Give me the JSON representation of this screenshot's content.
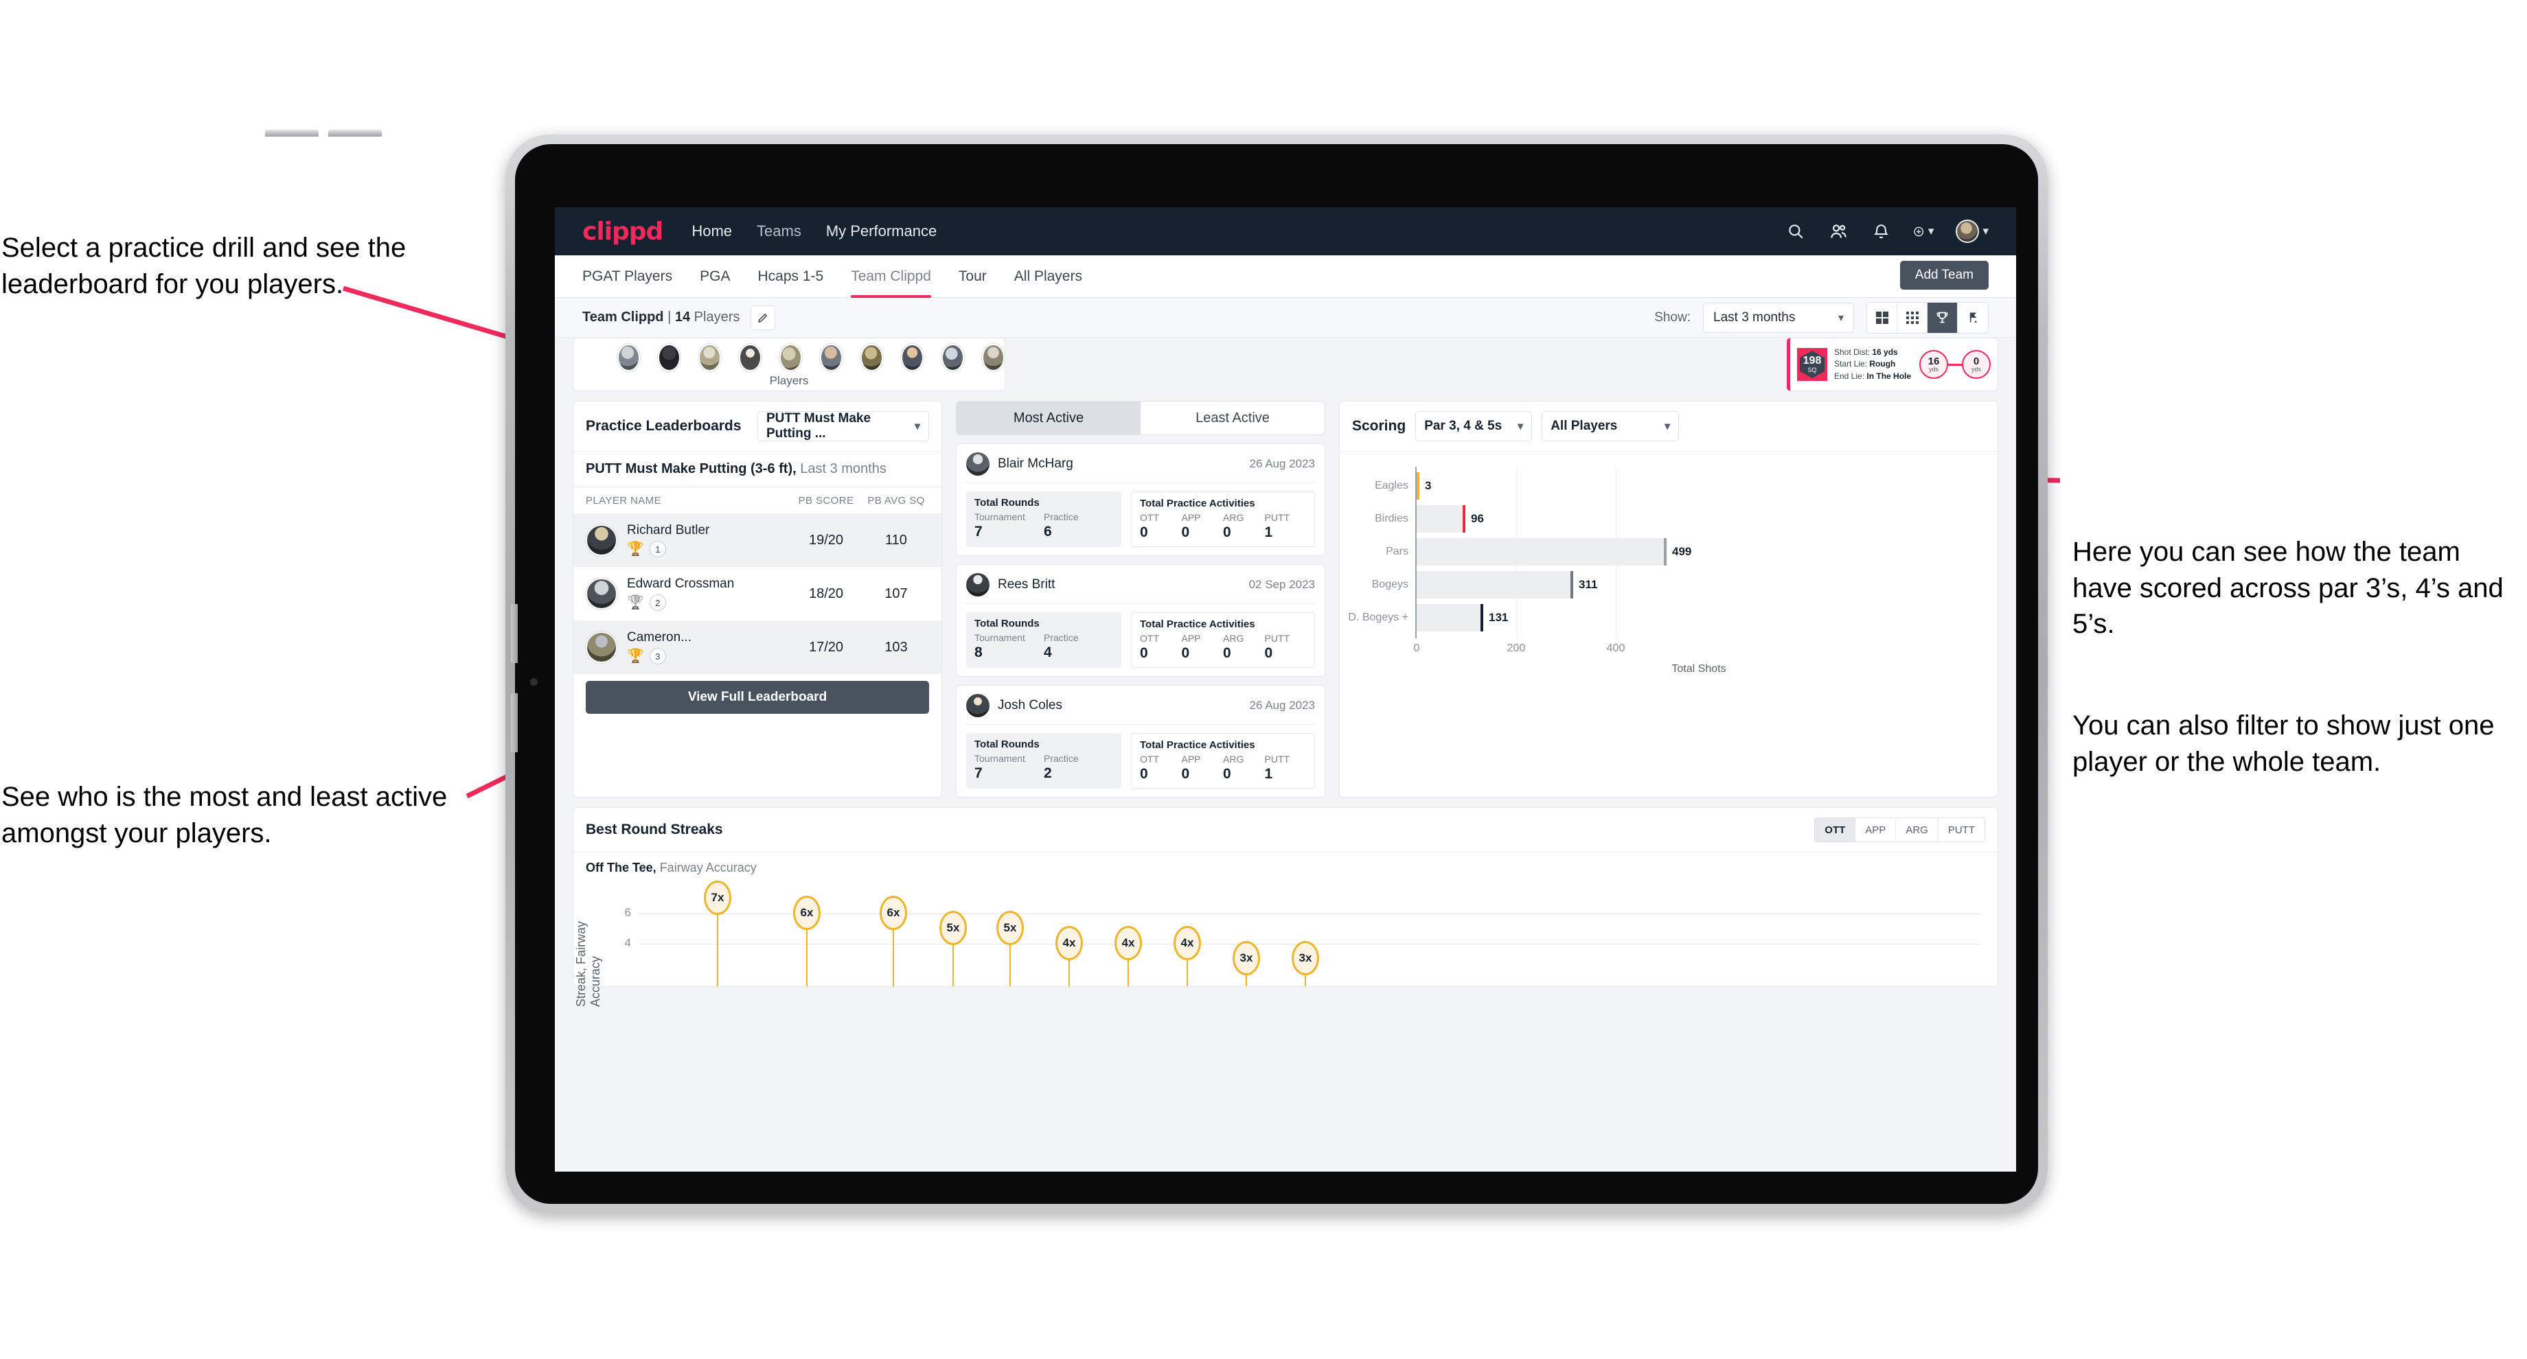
{
  "annotations": {
    "top_left": "Select a practice drill and see the leaderboard for you players.",
    "bottom_left": "See who is the most and least active amongst your players.",
    "right_1": "Here you can see how the team have scored across par 3’s, 4’s and 5’s.",
    "right_2": "You can also filter to show just one player or the whole team."
  },
  "navbar": {
    "logo": "clippd",
    "links": [
      "Home",
      "Teams",
      "My Performance"
    ],
    "icons": [
      "search-icon",
      "people-icon",
      "bell-icon",
      "plus-circle-icon",
      "avatar"
    ]
  },
  "tabs": {
    "items": [
      "PGAT Players",
      "PGA",
      "Hcaps 1-5",
      "Team Clippd",
      "Tour",
      "All Players"
    ],
    "active": "Team Clippd",
    "add_team_label": "Add Team"
  },
  "subbar": {
    "team_name": "Team Clippd",
    "separator": "|",
    "player_count": "14",
    "players_word": "Players",
    "show_label": "Show:",
    "range_value": "Last 3 months",
    "view_icons": [
      "grid-large-icon",
      "grid-small-icon",
      "trophy-icon",
      "flag-icon"
    ],
    "view_active": "trophy-icon"
  },
  "players_strip": {
    "caption": "Players",
    "avatar_count": 10
  },
  "shot_card": {
    "sq_value": "198",
    "sq_unit": "SQ",
    "lines": [
      {
        "label": "Shot Dist:",
        "value": "16 yds"
      },
      {
        "label": "Start Lie:",
        "value": "Rough"
      },
      {
        "label": "End Lie:",
        "value": "In The Hole"
      }
    ],
    "start_circle": {
      "value": "16",
      "unit": "yds"
    },
    "end_circle": {
      "value": "0",
      "unit": "yds"
    }
  },
  "leaderboard": {
    "title": "Practice Leaderboards",
    "drill_select": "PUTT Must Make Putting ...",
    "subtitle_bold": "PUTT Must Make Putting (3-6 ft),",
    "subtitle_rest": " Last 3 months",
    "columns": [
      "PLAYER NAME",
      "PB SCORE",
      "PB AVG SQ"
    ],
    "rows": [
      {
        "name": "Richard Butler",
        "rank": "1",
        "trophy": "gold",
        "pb_score": "19/20",
        "pb_avg_sq": "110"
      },
      {
        "name": "Edward Crossman",
        "rank": "2",
        "trophy": "silver",
        "pb_score": "18/20",
        "pb_avg_sq": "107"
      },
      {
        "name": "Cameron...",
        "rank": "3",
        "trophy": "bronze",
        "pb_score": "17/20",
        "pb_avg_sq": "103"
      }
    ],
    "button_label": "View Full Leaderboard"
  },
  "activity": {
    "tabs": [
      "Most Active",
      "Least Active"
    ],
    "active_tab": "Most Active",
    "rounds_title": "Total Rounds",
    "rounds_cols": [
      "Tournament",
      "Practice"
    ],
    "practice_title": "Total Practice Activities",
    "practice_cols": [
      "OTT",
      "APP",
      "ARG",
      "PUTT"
    ],
    "players": [
      {
        "name": "Blair McHarg",
        "date": "26 Aug 2023",
        "tournament": "7",
        "practice": "6",
        "ott": "0",
        "app": "0",
        "arg": "0",
        "putt": "1"
      },
      {
        "name": "Rees Britt",
        "date": "02 Sep 2023",
        "tournament": "8",
        "practice": "4",
        "ott": "0",
        "app": "0",
        "arg": "0",
        "putt": "0"
      },
      {
        "name": "Josh Coles",
        "date": "26 Aug 2023",
        "tournament": "7",
        "practice": "2",
        "ott": "0",
        "app": "0",
        "arg": "0",
        "putt": "1"
      }
    ]
  },
  "scoring": {
    "title": "Scoring",
    "par_select": "Par 3, 4 & 5s",
    "player_select": "All Players"
  },
  "streaks": {
    "title": "Best Round Streaks",
    "segments": [
      "OTT",
      "APP",
      "ARG",
      "PUTT"
    ],
    "active_segment": "OTT",
    "subtitle_bold": "Off The Tee,",
    "subtitle_rest": " Fairway Accuracy"
  },
  "colors": {
    "brand_pink": "#ee2a5c",
    "navy": "#16212f",
    "slate": "#48535f",
    "amber": "#f0b429",
    "bar_fill": "#eceef0"
  },
  "chart_data": [
    {
      "type": "bar",
      "orientation": "horizontal",
      "title": "Scoring",
      "categories": [
        "Eagles",
        "Birdies",
        "Pars",
        "Bogeys",
        "D. Bogeys +"
      ],
      "values": [
        3,
        96,
        499,
        311,
        131
      ],
      "cap_colors": [
        "#f0b429",
        "#e8283f",
        "#9aa1a8",
        "#6f7780",
        "#16212f"
      ],
      "xlabel": "Total Shots",
      "ylabel": "",
      "xlim": [
        0,
        560
      ],
      "xticks": [
        0,
        200,
        400
      ],
      "grid": true,
      "legend": "none"
    },
    {
      "type": "scatter",
      "title": "Best Round Streaks",
      "subtitle": "Off The Tee, Fairway Accuracy",
      "ylabel": "Streak, Fairway Accuracy",
      "xlabel": "",
      "ylim": [
        0,
        7.6
      ],
      "yticks": [
        4,
        6
      ],
      "values": [
        7,
        6,
        6,
        5,
        5,
        4,
        4,
        4,
        3,
        3
      ],
      "labels": [
        "7x",
        "6x",
        "6x",
        "5x",
        "5x",
        "4x",
        "4x",
        "4x",
        "3x",
        "3x"
      ],
      "marker": "lollipop",
      "marker_color": "#f0b429",
      "grid": true
    }
  ]
}
